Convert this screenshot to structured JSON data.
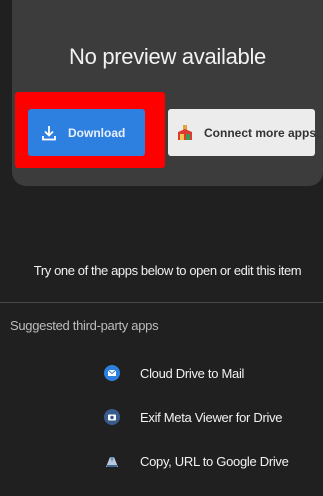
{
  "preview": {
    "title": "No preview available"
  },
  "actions": {
    "download_label": "Download",
    "connect_label": "Connect more apps..."
  },
  "info": {
    "try_text": "Try one of the apps below to open or edit this item"
  },
  "suggested": {
    "label": "Suggested third-party apps",
    "apps": [
      {
        "name": "Cloud Drive to Mail",
        "icon": "mail-icon",
        "color": "#2d7fe0"
      },
      {
        "name": "Exif Meta Viewer for Drive",
        "icon": "camera-icon",
        "color": "#3a5a8c"
      },
      {
        "name": "Copy, URL to Google Drive",
        "icon": "drive-upload-icon",
        "color": "#6a8fb5"
      }
    ]
  },
  "colors": {
    "background": "#202020",
    "card": "#3c3c3c",
    "download_button": "#2d7fe0",
    "highlight": "#ff0000",
    "connect_button": "#ececec"
  }
}
